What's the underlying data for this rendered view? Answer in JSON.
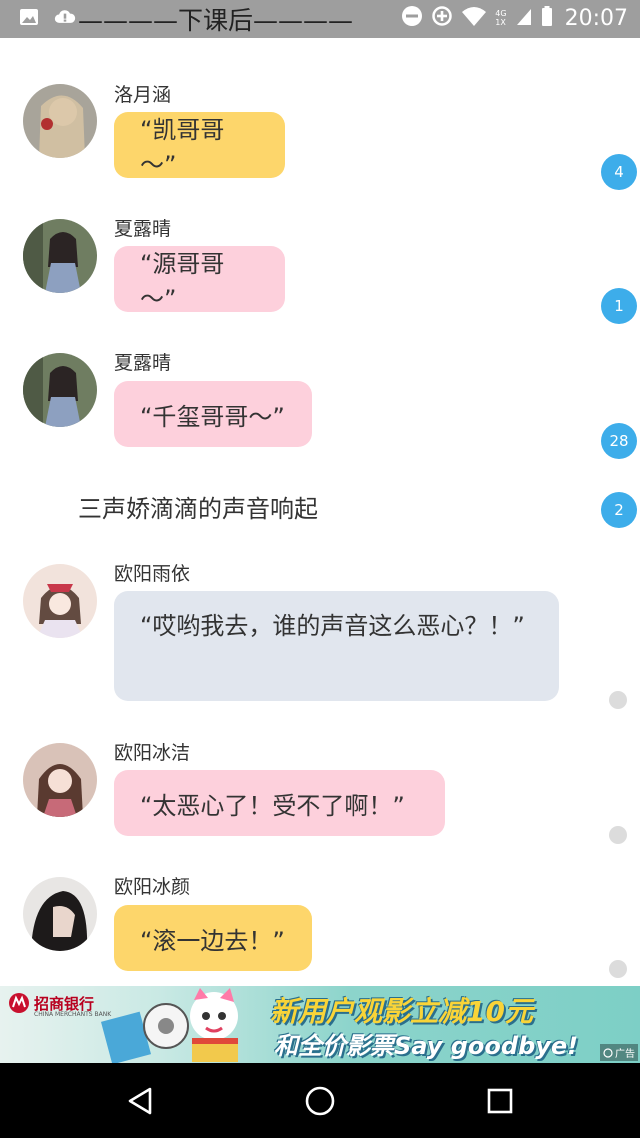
{
  "status_bar": {
    "time": "20:07",
    "network_top": "4G",
    "network_bottom": "1X"
  },
  "chapter_title": "————下课后————",
  "messages": [
    {
      "sender": "洛月涵",
      "text": "“凯哥哥～”",
      "color": "#fdd66b"
    },
    {
      "sender": "夏露晴",
      "text": "“源哥哥～”",
      "color": "#fdd0dc"
    },
    {
      "sender": "夏露晴",
      "text": "“千玺哥哥～”",
      "color": "#fdd0dc"
    },
    {
      "sender": "欧阳雨依",
      "text": "“哎哟我去，谁的声音这么恶心？！”",
      "color": "#e1e6ee"
    },
    {
      "sender": "欧阳冰洁",
      "text": "“太恶心了！受不了啊！”",
      "color": "#fdd0dc"
    },
    {
      "sender": "欧阳冰颜",
      "text": "“滚一边去！”",
      "color": "#fdd66b"
    }
  ],
  "narration": "三声娇滴滴的声音响起",
  "badges": [
    "4",
    "1",
    "28",
    "2"
  ],
  "ad": {
    "bank_name": "招商银行",
    "bank_sub": "CHINA MERCHANTS BANK",
    "headline": "新用户观影立减10元",
    "sub": "和全价影票Say goodbye!",
    "mark": "广告"
  },
  "icons": [
    "image-icon",
    "cloud-alert-icon",
    "dnd-icon",
    "data-saver-icon",
    "wifi-icon",
    "signal-icon",
    "battery-icon",
    "back-icon",
    "home-icon",
    "recents-icon"
  ]
}
